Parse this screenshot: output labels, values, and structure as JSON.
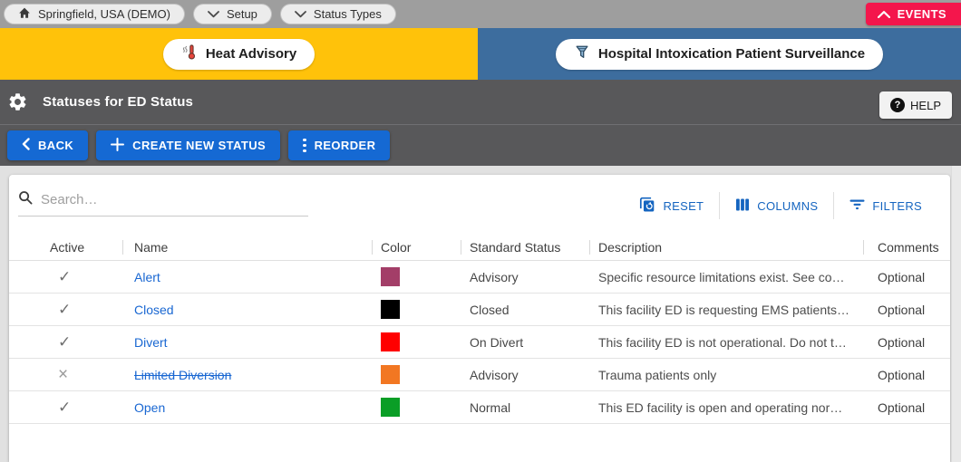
{
  "colors": {
    "topbar_gray": "#9E9E9E",
    "band_dark": "#58585A",
    "banner_yellow": "#FFC20A",
    "banner_blue": "#3D6D9E",
    "btn_blue": "#1569D3",
    "link_blue": "#1967D2",
    "ctrl_blue": "#1565C0",
    "events_red": "#F4164C",
    "content_bg": "#E1E1E1"
  },
  "icons": {
    "check": "✓",
    "cross": "×",
    "question": "?"
  },
  "topbar": {
    "breadcrumbs": [
      {
        "label": "Springfield, USA (DEMO)"
      },
      {
        "label": "Setup"
      },
      {
        "label": "Status Types"
      }
    ],
    "events_label": "EVENTS"
  },
  "banners": {
    "heat_advisory_label": "Heat Advisory",
    "surveillance_label": "Hospital Intoxication Patient Surveillance"
  },
  "header": {
    "title": "Statuses for ED Status",
    "help_label": "HELP"
  },
  "toolbar": {
    "back_label": "BACK",
    "create_label": "CREATE NEW STATUS",
    "reorder_label": "REORDER"
  },
  "table_controls": {
    "search_placeholder": "Search…",
    "reset_label": "RESET",
    "columns_label": "COLUMNS",
    "filters_label": "FILTERS"
  },
  "table": {
    "columns": [
      "Active",
      "Name",
      "Color",
      "Standard Status",
      "Description",
      "Comments"
    ],
    "rows": [
      {
        "active": true,
        "name": "Alert",
        "color": "#A33E68",
        "standard_status": "Advisory",
        "description": "Specific resource limitations exist. See co…",
        "comments": "Optional",
        "strikethrough": false
      },
      {
        "active": true,
        "name": "Closed",
        "color": "#000000",
        "standard_status": "Closed",
        "description": "This facility ED is requesting EMS patients…",
        "comments": "Optional",
        "strikethrough": false
      },
      {
        "active": true,
        "name": "Divert",
        "color": "#FF0000",
        "standard_status": "On Divert",
        "description": "This facility ED is not operational. Do not t…",
        "comments": "Optional",
        "strikethrough": false
      },
      {
        "active": false,
        "name": "Limited Diversion",
        "color": "#F27722",
        "standard_status": "Advisory",
        "description": "Trauma patients only",
        "comments": "Optional",
        "strikethrough": true
      },
      {
        "active": true,
        "name": "Open",
        "color": "#0A9E26",
        "standard_status": "Normal",
        "description": "This ED facility is open and operating nor…",
        "comments": "Optional",
        "strikethrough": false
      }
    ]
  }
}
